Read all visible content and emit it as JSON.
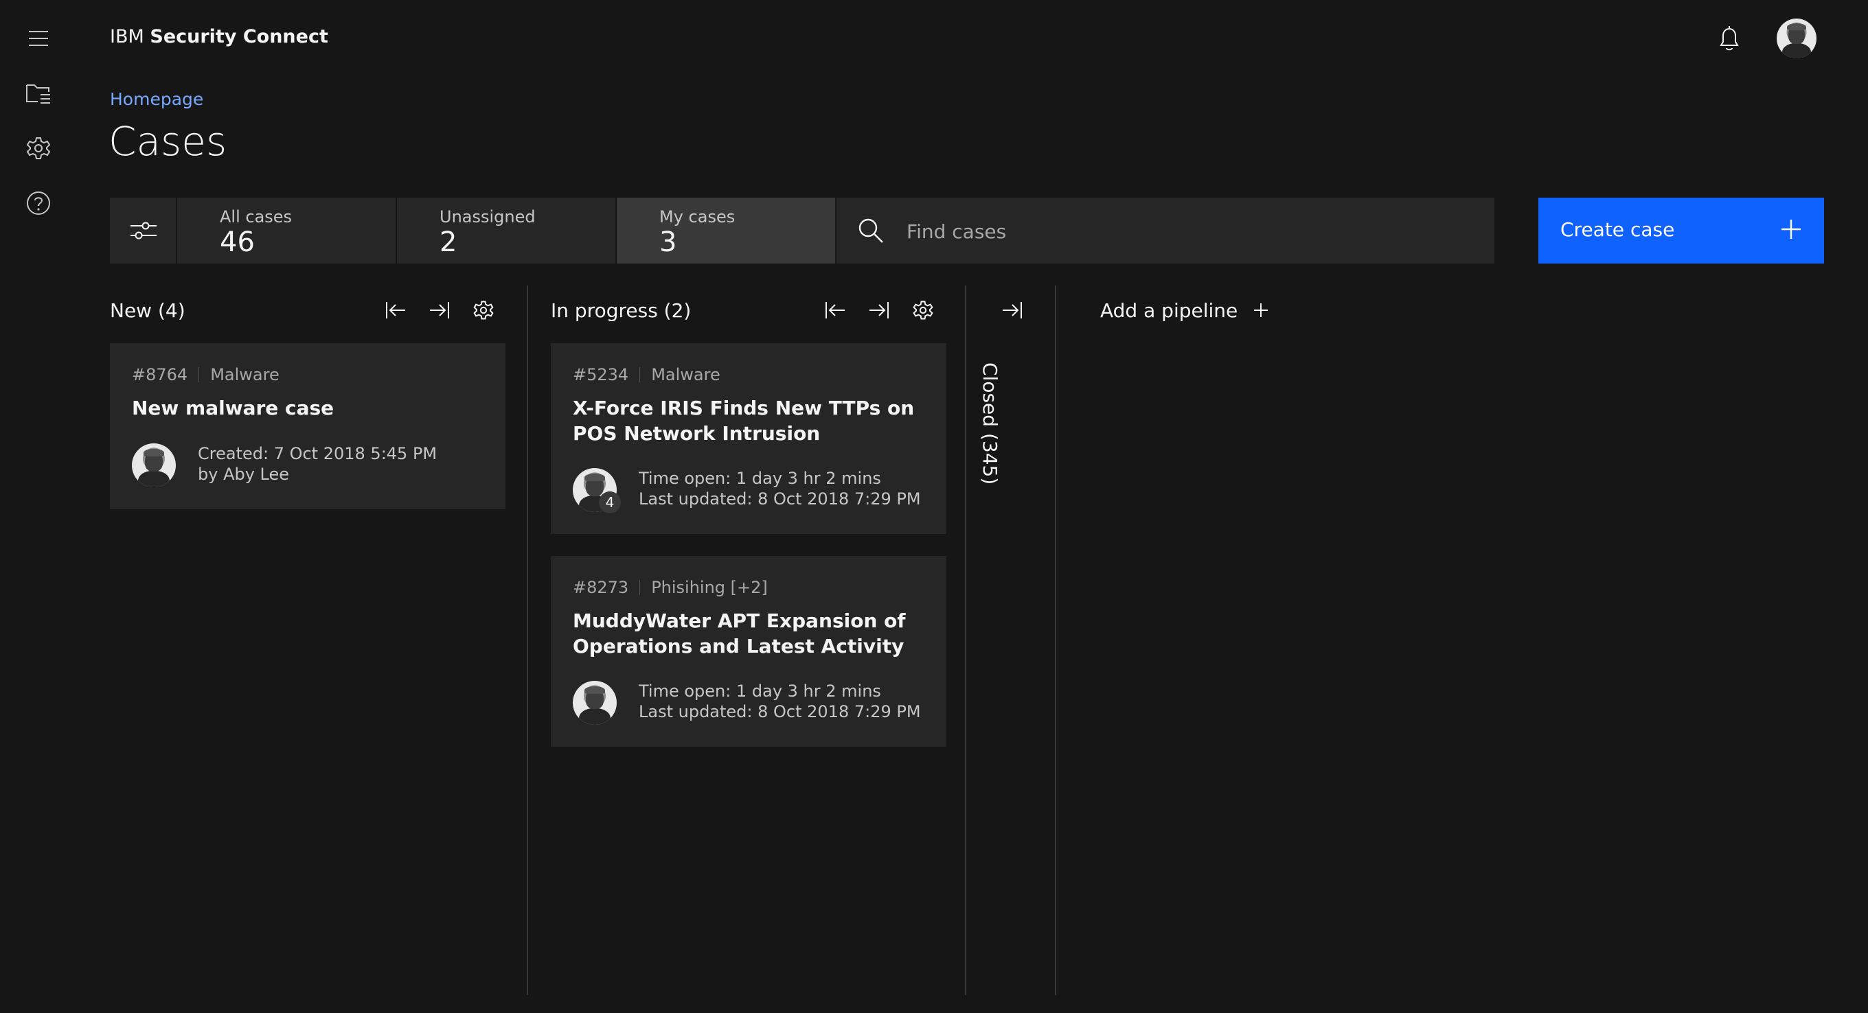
{
  "app": {
    "title_prefix": "IBM",
    "title_strong": "Security Connect"
  },
  "nav": {
    "icons": [
      "menu-icon",
      "folder-list-icon",
      "settings-icon",
      "help-icon"
    ]
  },
  "breadcrumb": "Homepage",
  "page_title": "Cases",
  "filters": {
    "all": {
      "label": "All cases",
      "count": "46"
    },
    "unassigned": {
      "label": "Unassigned",
      "count": "2"
    },
    "mine": {
      "label": "My cases",
      "count": "3"
    }
  },
  "search": {
    "placeholder": "Find cases"
  },
  "create_button": "Create case",
  "columns": {
    "new": {
      "title": "New (4)",
      "cards": [
        {
          "id": "#8764",
          "category": "Malware",
          "title": "New malware case",
          "line1": "Created: 7 Oct 2018 5:45 PM",
          "line2": "by Aby Lee"
        }
      ]
    },
    "in_progress": {
      "title": "In progress (2)",
      "cards": [
        {
          "id": "#5234",
          "category": "Malware",
          "title": "X-Force IRIS Finds New TTPs on POS Network Intrusion",
          "line1": "Time open: 1 day 3 hr 2 mins",
          "line2": "Last updated: 8 Oct 2018 7:29 PM",
          "badge": "4"
        },
        {
          "id": "#8273",
          "category": "Phisihing [+2]",
          "title": "MuddyWater APT Expansion of Operations and Latest Activity",
          "line1": "Time open: 1 day 3 hr 2 mins",
          "line2": "Last updated: 8 Oct 2018 7:29 PM"
        }
      ]
    },
    "closed": {
      "title": "Closed (345)"
    }
  },
  "add_pipeline": "Add a pipeline",
  "colors": {
    "background": "#161616",
    "surface": "#262626",
    "accent": "#0f62fe",
    "link": "#78a9ff"
  }
}
